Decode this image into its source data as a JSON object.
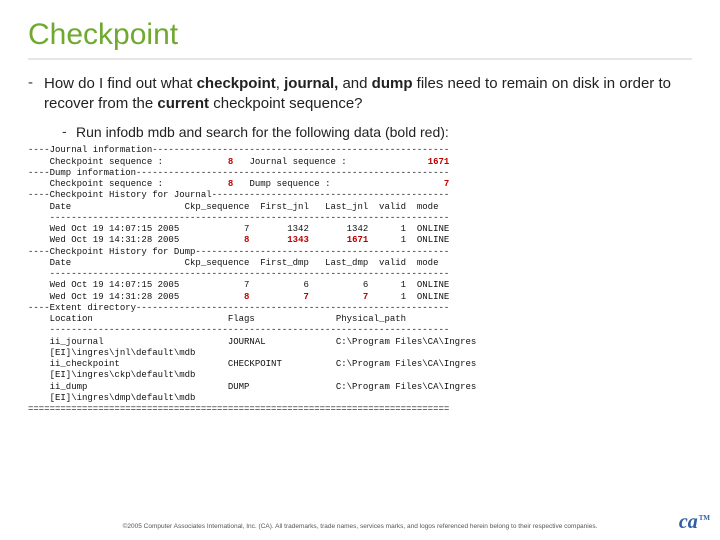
{
  "title": "Checkpoint",
  "bullet": {
    "pre": "How do I find out what ",
    "k1": "checkpoint",
    "mid1": ", ",
    "k2": "journal,",
    "mid2": " and ",
    "k3": "dump",
    "mid3": " files need to remain on disk in order to recover from the ",
    "k4": "current",
    "post": " checkpoint sequence?"
  },
  "subbullet": "Run infodb mdb and search for the following data (bold red):",
  "lines": {
    "l01a": "----Journal information-------------------------------------------------------",
    "l02a": "    Checkpoint sequence :            ",
    "l02b": "8",
    "l02c": "   Journal sequence :               ",
    "l02d": "1671",
    "l03a": "----Dump information----------------------------------------------------------",
    "l04a": "    Checkpoint sequence :            ",
    "l04b": "8",
    "l04c": "   Dump sequence :                     ",
    "l04d": "7",
    "l05": "----Checkpoint History for Journal--------------------------------------------",
    "l06": "    Date                     Ckp_sequence  First_jnl   Last_jnl  valid  mode",
    "l07": "    --------------------------------------------------------------------------",
    "l08": "    Wed Oct 19 14:07:15 2005            7       1342       1342      1  ONLINE",
    "l09a": "    Wed Oct 19 14:31:28 2005            ",
    "l09b": "8",
    "l09c": "       ",
    "l09d": "1343",
    "l09e": "       ",
    "l09f": "1671",
    "l09g": "      1  ONLINE",
    "l10": "----Checkpoint History for Dump-----------------------------------------------",
    "l11": "    Date                     Ckp_sequence  First_dmp   Last_dmp  valid  mode",
    "l12": "    --------------------------------------------------------------------------",
    "l13": "    Wed Oct 19 14:07:15 2005            7          6          6      1  ONLINE",
    "l14a": "    Wed Oct 19 14:31:28 2005            ",
    "l14b": "8",
    "l14c": "          ",
    "l14d": "7",
    "l14e": "          ",
    "l14f": "7",
    "l14g": "      1  ONLINE",
    "l15": "----Extent directory----------------------------------------------------------",
    "l16": "    Location                         Flags               Physical_path",
    "l17": "    --------------------------------------------------------------------------",
    "l18": "    ii_journal                       JOURNAL             C:\\Program Files\\CA\\Ingres",
    "l19": "    [EI]\\ingres\\jnl\\default\\mdb",
    "l20": "    ii_checkpoint                    CHECKPOINT          C:\\Program Files\\CA\\Ingres",
    "l21": "    [EI]\\ingres\\ckp\\default\\mdb",
    "l22": "    ii_dump                          DUMP                C:\\Program Files\\CA\\Ingres",
    "l23": "    [EI]\\ingres\\dmp\\default\\mdb",
    "l24": "=============================================================================="
  },
  "footer": "©2005 Computer Associates International, Inc. (CA). All trademarks, trade names, services marks, and logos referenced herein belong to their respective companies.",
  "logo": "ca",
  "tm": "TM"
}
